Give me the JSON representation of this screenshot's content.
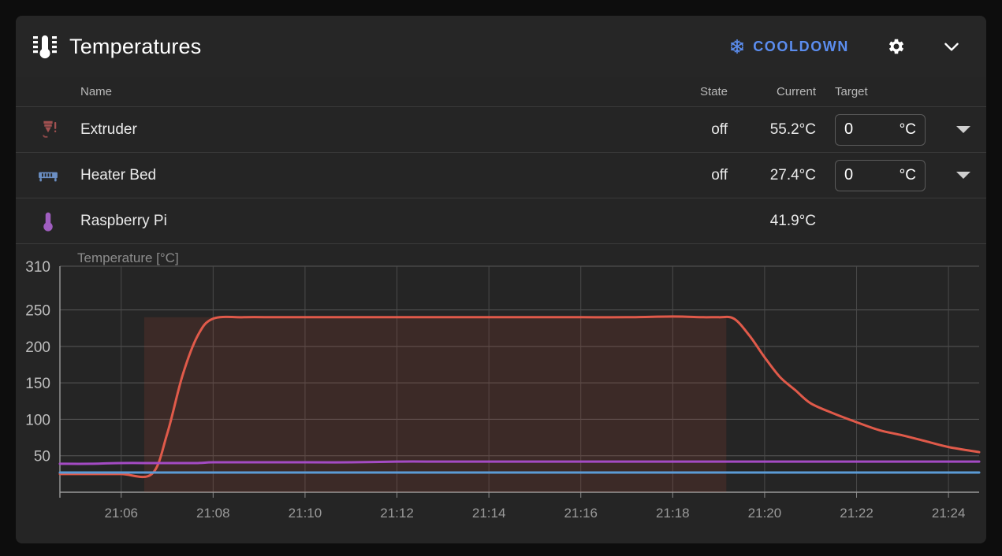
{
  "panel": {
    "title": "Temperatures",
    "title_icon": "thermometer-icon",
    "cooldown_label": "COOLDOWN",
    "cooldown_icon": "snowflake-icon",
    "cooldown_color": "#5b8def",
    "settings_icon": "gear-icon",
    "collapse_icon": "chevron-down-icon"
  },
  "table": {
    "headers": {
      "name": "Name",
      "state": "State",
      "current": "Current",
      "target": "Target"
    },
    "rows": [
      {
        "icon": "extruder-nozzle-icon",
        "icon_color": "#a05050",
        "name": "Extruder",
        "state": "off",
        "current": "55.2°C",
        "target_value": "0",
        "target_unit": "°C",
        "has_target": true,
        "has_chevron": true
      },
      {
        "icon": "heater-bed-icon",
        "icon_color": "#6b8fc4",
        "name": "Heater Bed",
        "state": "off",
        "current": "27.4°C",
        "target_value": "0",
        "target_unit": "°C",
        "has_target": true,
        "has_chevron": true
      },
      {
        "icon": "thermometer-icon",
        "icon_color": "#a05ec0",
        "name": "Raspberry Pi",
        "state": "",
        "current": "41.9°C",
        "target_value": "",
        "target_unit": "",
        "has_target": false,
        "has_chevron": false
      }
    ]
  },
  "chart_data": {
    "type": "line",
    "title": "",
    "ylabel": "Temperature [°C]",
    "xlabel": "",
    "grid": true,
    "legend": "none",
    "ylim": [
      0,
      310
    ],
    "yticks": [
      50,
      100,
      150,
      200,
      250,
      310
    ],
    "xticks": [
      "21:06",
      "21:08",
      "21:10",
      "21:12",
      "21:14",
      "21:16",
      "21:18",
      "21:20",
      "21:22",
      "21:24"
    ],
    "xlim": [
      "21:04:40",
      "21:24:40"
    ],
    "x": [
      "21:04:40",
      "21:05:20",
      "21:06:00",
      "21:06:40",
      "21:07:00",
      "21:07:20",
      "21:07:40",
      "21:08:00",
      "21:08:40",
      "21:09:20",
      "21:10:00",
      "21:11:00",
      "21:12:00",
      "21:13:00",
      "21:14:00",
      "21:15:00",
      "21:16:00",
      "21:17:00",
      "21:18:00",
      "21:18:40",
      "21:19:00",
      "21:19:20",
      "21:19:40",
      "21:20:00",
      "21:20:20",
      "21:20:40",
      "21:21:00",
      "21:21:30",
      "21:22:00",
      "21:22:30",
      "21:23:00",
      "21:23:30",
      "21:24:00",
      "21:24:40"
    ],
    "series": [
      {
        "name": "Extruder",
        "color": "#e05a4a",
        "fill_color": "rgba(190,70,50,0.18)",
        "values": [
          25,
          25,
          25,
          25,
          80,
          160,
          215,
          238,
          240,
          240,
          240,
          240,
          240,
          240,
          240,
          240,
          240,
          240,
          241,
          240,
          240,
          238,
          215,
          185,
          158,
          140,
          122,
          108,
          96,
          85,
          78,
          70,
          62,
          55
        ]
      },
      {
        "name": "Raspberry Pi",
        "color": "#a44bc4",
        "values": [
          39,
          39,
          40,
          40,
          40,
          40,
          40,
          41,
          41,
          41,
          41,
          41,
          42,
          42,
          42,
          42,
          42,
          42,
          42,
          42,
          42,
          42,
          42,
          42,
          42,
          42,
          42,
          42,
          42,
          42,
          42,
          42,
          42,
          42
        ]
      },
      {
        "name": "Heater Bed",
        "color": "#5b9bd5",
        "values": [
          27,
          27,
          27,
          27,
          27,
          27,
          27,
          27,
          27,
          27,
          27,
          27,
          27,
          27,
          27,
          27,
          27,
          27,
          27,
          27,
          27,
          27,
          27,
          27,
          27,
          27,
          27,
          27,
          27,
          27,
          27,
          27,
          27,
          27
        ]
      }
    ],
    "target_band": {
      "name": "Extruder target",
      "value": 240,
      "start": "21:06:30",
      "end": "21:19:10",
      "color": "rgba(180,70,50,0.16)"
    }
  }
}
